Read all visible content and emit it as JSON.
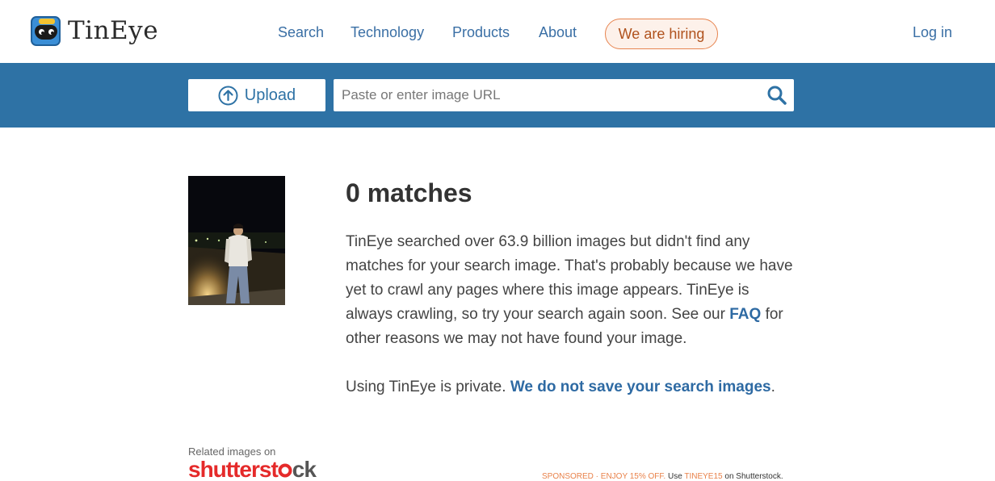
{
  "brand": {
    "name": "TinEye"
  },
  "nav": {
    "search": "Search",
    "technology": "Technology",
    "products": "Products",
    "about": "About",
    "hiring": "We are hiring",
    "login": "Log in"
  },
  "search_bar": {
    "upload_label": "Upload",
    "url_placeholder": "Paste or enter image URL"
  },
  "results": {
    "title": "0 matches",
    "body_1": "TinEye searched over 63.9 billion images but didn't find any matches for your search image. That's probably because we have yet to crawl any pages where this image appears. TinEye is always crawling, so try your search again soon. See our ",
    "faq_link": "FAQ",
    "body_2": " for other reasons we may not have found your image.",
    "privacy_text": "Using TinEye is private. ",
    "privacy_link": "We do not save your search images",
    "privacy_end": "."
  },
  "footer": {
    "related_label": "Related images on",
    "shutterstock_a": "shutterst",
    "shutterstock_b": "ck",
    "sponsored_a": "SPONSORED · ENJOY 15% OFF.",
    "sponsored_b": " Use ",
    "sponsored_code": "TINEYE15",
    "sponsored_c": " on Shutterstock."
  },
  "colors": {
    "accent_blue": "#2e72a5",
    "link_blue": "#3a6fa5",
    "hiring_orange": "#e7844f",
    "shutterstock_red": "#e52a2a"
  }
}
